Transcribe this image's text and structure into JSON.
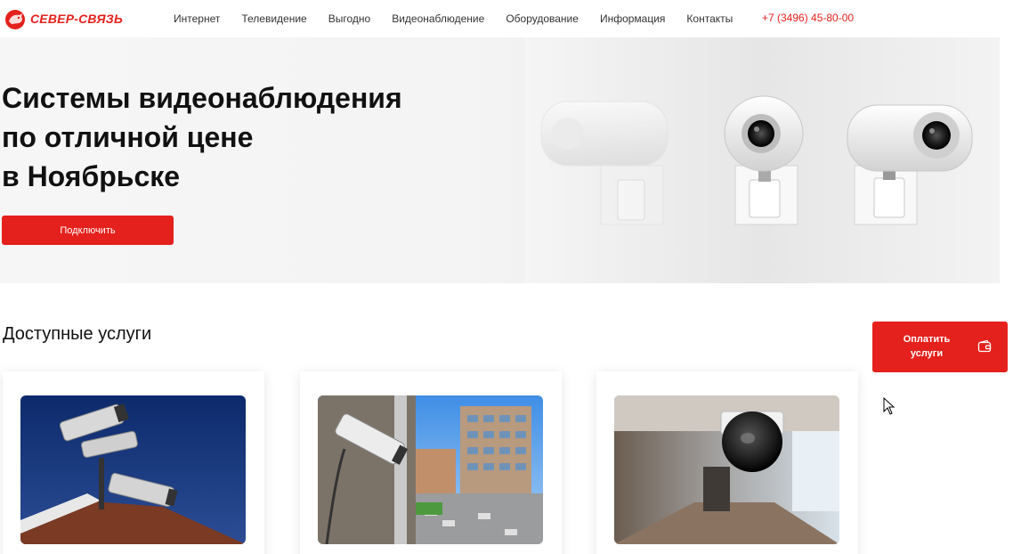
{
  "header": {
    "logo_text": "СЕВЕР-СВЯЗЬ",
    "nav": [
      "Интернет",
      "Телевидение",
      "Выгодно",
      "Видеонаблюдение",
      "Оборудование",
      "Информация",
      "Контакты"
    ],
    "phone": "+7 (3496) 45-80-00"
  },
  "hero": {
    "title_lines": [
      "Системы видеонаблюдения",
      "по отличной цене",
      "в Ноябрьске"
    ],
    "connect_button": "Подключить"
  },
  "services": {
    "title": "Доступные услуги",
    "pay_button": "Оплатить услуги",
    "cards": [
      {
        "image": "outdoor-cameras-photo"
      },
      {
        "image": "building-camera-photo"
      },
      {
        "image": "dome-camera-photo"
      }
    ]
  },
  "colors": {
    "accent": "#e4211d",
    "text": "#111111",
    "hero_bg": "#f4f4f4"
  },
  "icons": [
    "logo-bear-icon",
    "wallet-icon",
    "mouse-cursor-icon"
  ]
}
